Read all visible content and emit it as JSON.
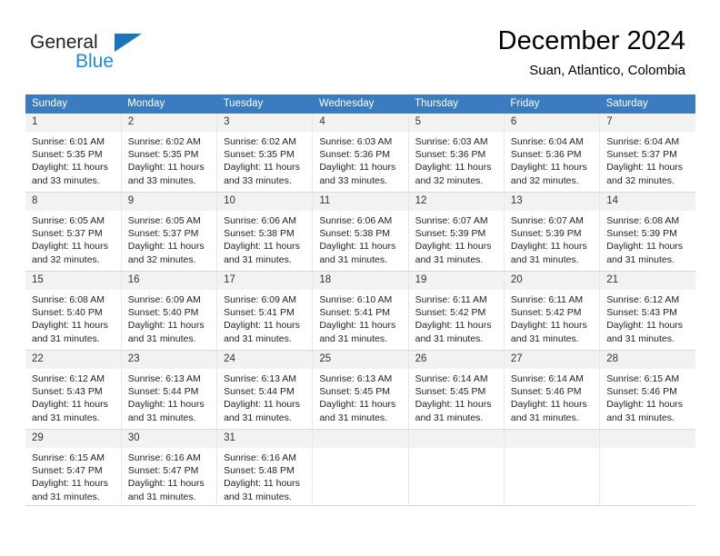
{
  "brand": {
    "name_top": "General",
    "name_bottom": "Blue",
    "triangle_color": "#1b75bb",
    "bottom_color": "#1b8ae0"
  },
  "header": {
    "title": "December 2024",
    "subtitle": "Suan, Atlantico, Colombia",
    "header_bg": "#3a7cbe",
    "daynum_bg": "#f2f2f2"
  },
  "weekday_headers": [
    "Sunday",
    "Monday",
    "Tuesday",
    "Wednesday",
    "Thursday",
    "Friday",
    "Saturday"
  ],
  "weeks": [
    [
      {
        "day": "1",
        "sunrise": "Sunrise: 6:01 AM",
        "sunset": "Sunset: 5:35 PM",
        "daylight_l1": "Daylight: 11 hours",
        "daylight_l2": "and 33 minutes."
      },
      {
        "day": "2",
        "sunrise": "Sunrise: 6:02 AM",
        "sunset": "Sunset: 5:35 PM",
        "daylight_l1": "Daylight: 11 hours",
        "daylight_l2": "and 33 minutes."
      },
      {
        "day": "3",
        "sunrise": "Sunrise: 6:02 AM",
        "sunset": "Sunset: 5:35 PM",
        "daylight_l1": "Daylight: 11 hours",
        "daylight_l2": "and 33 minutes."
      },
      {
        "day": "4",
        "sunrise": "Sunrise: 6:03 AM",
        "sunset": "Sunset: 5:36 PM",
        "daylight_l1": "Daylight: 11 hours",
        "daylight_l2": "and 33 minutes."
      },
      {
        "day": "5",
        "sunrise": "Sunrise: 6:03 AM",
        "sunset": "Sunset: 5:36 PM",
        "daylight_l1": "Daylight: 11 hours",
        "daylight_l2": "and 32 minutes."
      },
      {
        "day": "6",
        "sunrise": "Sunrise: 6:04 AM",
        "sunset": "Sunset: 5:36 PM",
        "daylight_l1": "Daylight: 11 hours",
        "daylight_l2": "and 32 minutes."
      },
      {
        "day": "7",
        "sunrise": "Sunrise: 6:04 AM",
        "sunset": "Sunset: 5:37 PM",
        "daylight_l1": "Daylight: 11 hours",
        "daylight_l2": "and 32 minutes."
      }
    ],
    [
      {
        "day": "8",
        "sunrise": "Sunrise: 6:05 AM",
        "sunset": "Sunset: 5:37 PM",
        "daylight_l1": "Daylight: 11 hours",
        "daylight_l2": "and 32 minutes."
      },
      {
        "day": "9",
        "sunrise": "Sunrise: 6:05 AM",
        "sunset": "Sunset: 5:37 PM",
        "daylight_l1": "Daylight: 11 hours",
        "daylight_l2": "and 32 minutes."
      },
      {
        "day": "10",
        "sunrise": "Sunrise: 6:06 AM",
        "sunset": "Sunset: 5:38 PM",
        "daylight_l1": "Daylight: 11 hours",
        "daylight_l2": "and 31 minutes."
      },
      {
        "day": "11",
        "sunrise": "Sunrise: 6:06 AM",
        "sunset": "Sunset: 5:38 PM",
        "daylight_l1": "Daylight: 11 hours",
        "daylight_l2": "and 31 minutes."
      },
      {
        "day": "12",
        "sunrise": "Sunrise: 6:07 AM",
        "sunset": "Sunset: 5:39 PM",
        "daylight_l1": "Daylight: 11 hours",
        "daylight_l2": "and 31 minutes."
      },
      {
        "day": "13",
        "sunrise": "Sunrise: 6:07 AM",
        "sunset": "Sunset: 5:39 PM",
        "daylight_l1": "Daylight: 11 hours",
        "daylight_l2": "and 31 minutes."
      },
      {
        "day": "14",
        "sunrise": "Sunrise: 6:08 AM",
        "sunset": "Sunset: 5:39 PM",
        "daylight_l1": "Daylight: 11 hours",
        "daylight_l2": "and 31 minutes."
      }
    ],
    [
      {
        "day": "15",
        "sunrise": "Sunrise: 6:08 AM",
        "sunset": "Sunset: 5:40 PM",
        "daylight_l1": "Daylight: 11 hours",
        "daylight_l2": "and 31 minutes."
      },
      {
        "day": "16",
        "sunrise": "Sunrise: 6:09 AM",
        "sunset": "Sunset: 5:40 PM",
        "daylight_l1": "Daylight: 11 hours",
        "daylight_l2": "and 31 minutes."
      },
      {
        "day": "17",
        "sunrise": "Sunrise: 6:09 AM",
        "sunset": "Sunset: 5:41 PM",
        "daylight_l1": "Daylight: 11 hours",
        "daylight_l2": "and 31 minutes."
      },
      {
        "day": "18",
        "sunrise": "Sunrise: 6:10 AM",
        "sunset": "Sunset: 5:41 PM",
        "daylight_l1": "Daylight: 11 hours",
        "daylight_l2": "and 31 minutes."
      },
      {
        "day": "19",
        "sunrise": "Sunrise: 6:11 AM",
        "sunset": "Sunset: 5:42 PM",
        "daylight_l1": "Daylight: 11 hours",
        "daylight_l2": "and 31 minutes."
      },
      {
        "day": "20",
        "sunrise": "Sunrise: 6:11 AM",
        "sunset": "Sunset: 5:42 PM",
        "daylight_l1": "Daylight: 11 hours",
        "daylight_l2": "and 31 minutes."
      },
      {
        "day": "21",
        "sunrise": "Sunrise: 6:12 AM",
        "sunset": "Sunset: 5:43 PM",
        "daylight_l1": "Daylight: 11 hours",
        "daylight_l2": "and 31 minutes."
      }
    ],
    [
      {
        "day": "22",
        "sunrise": "Sunrise: 6:12 AM",
        "sunset": "Sunset: 5:43 PM",
        "daylight_l1": "Daylight: 11 hours",
        "daylight_l2": "and 31 minutes."
      },
      {
        "day": "23",
        "sunrise": "Sunrise: 6:13 AM",
        "sunset": "Sunset: 5:44 PM",
        "daylight_l1": "Daylight: 11 hours",
        "daylight_l2": "and 31 minutes."
      },
      {
        "day": "24",
        "sunrise": "Sunrise: 6:13 AM",
        "sunset": "Sunset: 5:44 PM",
        "daylight_l1": "Daylight: 11 hours",
        "daylight_l2": "and 31 minutes."
      },
      {
        "day": "25",
        "sunrise": "Sunrise: 6:13 AM",
        "sunset": "Sunset: 5:45 PM",
        "daylight_l1": "Daylight: 11 hours",
        "daylight_l2": "and 31 minutes."
      },
      {
        "day": "26",
        "sunrise": "Sunrise: 6:14 AM",
        "sunset": "Sunset: 5:45 PM",
        "daylight_l1": "Daylight: 11 hours",
        "daylight_l2": "and 31 minutes."
      },
      {
        "day": "27",
        "sunrise": "Sunrise: 6:14 AM",
        "sunset": "Sunset: 5:46 PM",
        "daylight_l1": "Daylight: 11 hours",
        "daylight_l2": "and 31 minutes."
      },
      {
        "day": "28",
        "sunrise": "Sunrise: 6:15 AM",
        "sunset": "Sunset: 5:46 PM",
        "daylight_l1": "Daylight: 11 hours",
        "daylight_l2": "and 31 minutes."
      }
    ],
    [
      {
        "day": "29",
        "sunrise": "Sunrise: 6:15 AM",
        "sunset": "Sunset: 5:47 PM",
        "daylight_l1": "Daylight: 11 hours",
        "daylight_l2": "and 31 minutes."
      },
      {
        "day": "30",
        "sunrise": "Sunrise: 6:16 AM",
        "sunset": "Sunset: 5:47 PM",
        "daylight_l1": "Daylight: 11 hours",
        "daylight_l2": "and 31 minutes."
      },
      {
        "day": "31",
        "sunrise": "Sunrise: 6:16 AM",
        "sunset": "Sunset: 5:48 PM",
        "daylight_l1": "Daylight: 11 hours",
        "daylight_l2": "and 31 minutes."
      },
      {
        "day": "",
        "sunrise": "",
        "sunset": "",
        "daylight_l1": "",
        "daylight_l2": ""
      },
      {
        "day": "",
        "sunrise": "",
        "sunset": "",
        "daylight_l1": "",
        "daylight_l2": ""
      },
      {
        "day": "",
        "sunrise": "",
        "sunset": "",
        "daylight_l1": "",
        "daylight_l2": ""
      },
      {
        "day": "",
        "sunrise": "",
        "sunset": "",
        "daylight_l1": "",
        "daylight_l2": ""
      }
    ]
  ]
}
